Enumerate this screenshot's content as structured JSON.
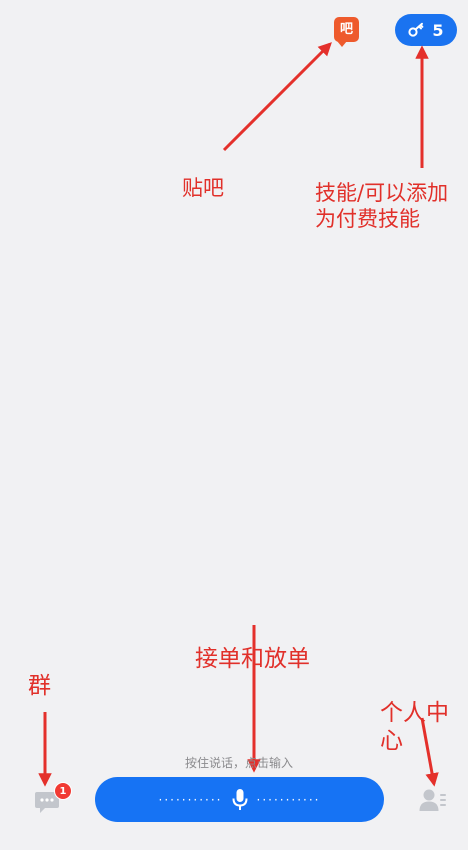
{
  "top_bar": {
    "tieba_icon_text": "吧",
    "skill_count": "5",
    "tieba_icon": "tieba-speech-bubble-icon",
    "skill_icon": "key-icon"
  },
  "annotations": {
    "tieba": "贴吧",
    "skills": "技能/可以添加\n为付费技能",
    "orders": "接单和放单",
    "group": "群",
    "profile": "个人中\n心"
  },
  "bottom_bar": {
    "hint": "按住说话，点击输入",
    "dots_left": "···········",
    "dots_right": "···········",
    "unread_badge": "1",
    "chat_icon": "chat-bubble-icon",
    "mic_icon": "microphone-icon",
    "profile_icon": "user-profile-icon"
  },
  "colors": {
    "background": "#f1f1f3",
    "accent_blue": "#1673f4",
    "annotation_red": "#e1302a",
    "tieba_orange": "#ee5a2c",
    "badge_red": "#f13a33"
  }
}
